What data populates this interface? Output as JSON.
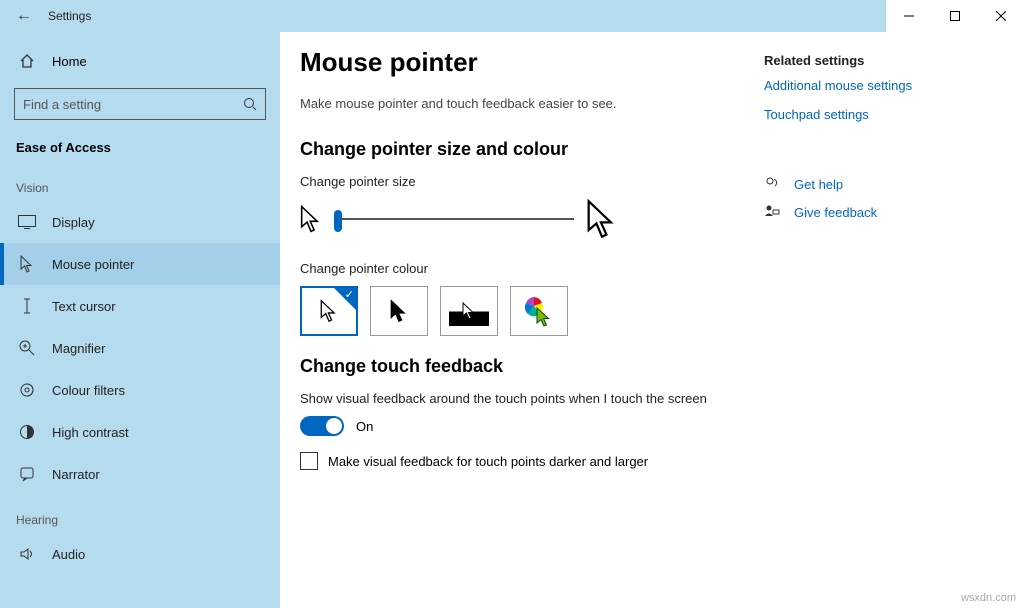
{
  "titlebar": {
    "back": "←",
    "title": "Settings"
  },
  "sidebar": {
    "home": "Home",
    "search_placeholder": "Find a setting",
    "category": "Ease of Access",
    "groups": [
      {
        "label": "Vision",
        "items": [
          {
            "key": "display",
            "label": "Display"
          },
          {
            "key": "mouse-pointer",
            "label": "Mouse pointer",
            "active": true
          },
          {
            "key": "text-cursor",
            "label": "Text cursor"
          },
          {
            "key": "magnifier",
            "label": "Magnifier"
          },
          {
            "key": "colour-filters",
            "label": "Colour filters"
          },
          {
            "key": "high-contrast",
            "label": "High contrast"
          },
          {
            "key": "narrator",
            "label": "Narrator"
          }
        ]
      },
      {
        "label": "Hearing",
        "items": [
          {
            "key": "audio",
            "label": "Audio"
          }
        ]
      }
    ]
  },
  "page": {
    "title": "Mouse pointer",
    "desc": "Make mouse pointer and touch feedback easier to see.",
    "size_colour_head": "Change pointer size and colour",
    "size_label": "Change pointer size",
    "colour_label": "Change pointer colour",
    "touch_head": "Change touch feedback",
    "touch_desc": "Show visual feedback around the touch points when I touch the screen",
    "toggle_state": "On",
    "cb_label": "Make visual feedback for touch points darker and larger"
  },
  "related": {
    "head": "Related settings",
    "links": [
      "Additional mouse settings",
      "Touchpad settings"
    ],
    "help": "Get help",
    "feedback": "Give feedback"
  },
  "watermark": "wsxdn.com"
}
